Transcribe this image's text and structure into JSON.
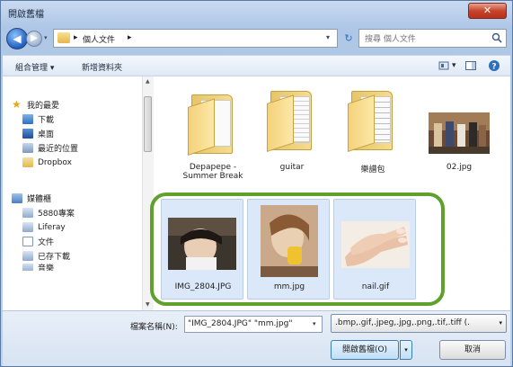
{
  "window": {
    "title": "開啟舊檔",
    "close_glyph": "✕"
  },
  "nav": {
    "back_glyph": "◀",
    "forward_glyph": "▶",
    "history_glyph": "▾",
    "address_sep1": "▸",
    "address_folder": "個人文件",
    "address_sep2": "▸",
    "address_drop": "▾",
    "refresh_glyph": "↻"
  },
  "search": {
    "placeholder": "搜尋 個人文件"
  },
  "toolbar": {
    "organize": "組合管理 ▾",
    "new_folder": "新增資料夾",
    "view_drop": "▾"
  },
  "sidebar": {
    "favorites": "我的最愛",
    "downloads": "下載",
    "desktop": "桌面",
    "recent": "最近的位置",
    "dropbox": "Dropbox",
    "libraries": "媒體櫃",
    "lib_5880": "5880專案",
    "liferay": "Liferay",
    "documents": "文件",
    "lib_downloads": "已存下載",
    "music": "音樂"
  },
  "files": {
    "depapepe": "Depapepe - Summer Break",
    "guitar": "guitar",
    "scores": "樂譜包",
    "f02": "02.jpg",
    "img2804": "IMG_2804.JPG",
    "mm": "mm.jpg",
    "nail": "nail.gif"
  },
  "bottom": {
    "filename_label": "檔案名稱(N):",
    "filename_value": "\"IMG_2804.JPG\" \"mm.jpg\"",
    "filename_drop": "▾",
    "type_filter": ".bmp,.gif,.jpeg,.jpg,.png,.tif,.tiff (.",
    "type_drop": "▾",
    "open": "開啟舊檔(O)",
    "open_drop": "▾",
    "cancel": "取消"
  },
  "colors": {
    "highlight": "#5fa12a",
    "selection": "#dbe8f9",
    "accent": "#2f6fbe"
  }
}
